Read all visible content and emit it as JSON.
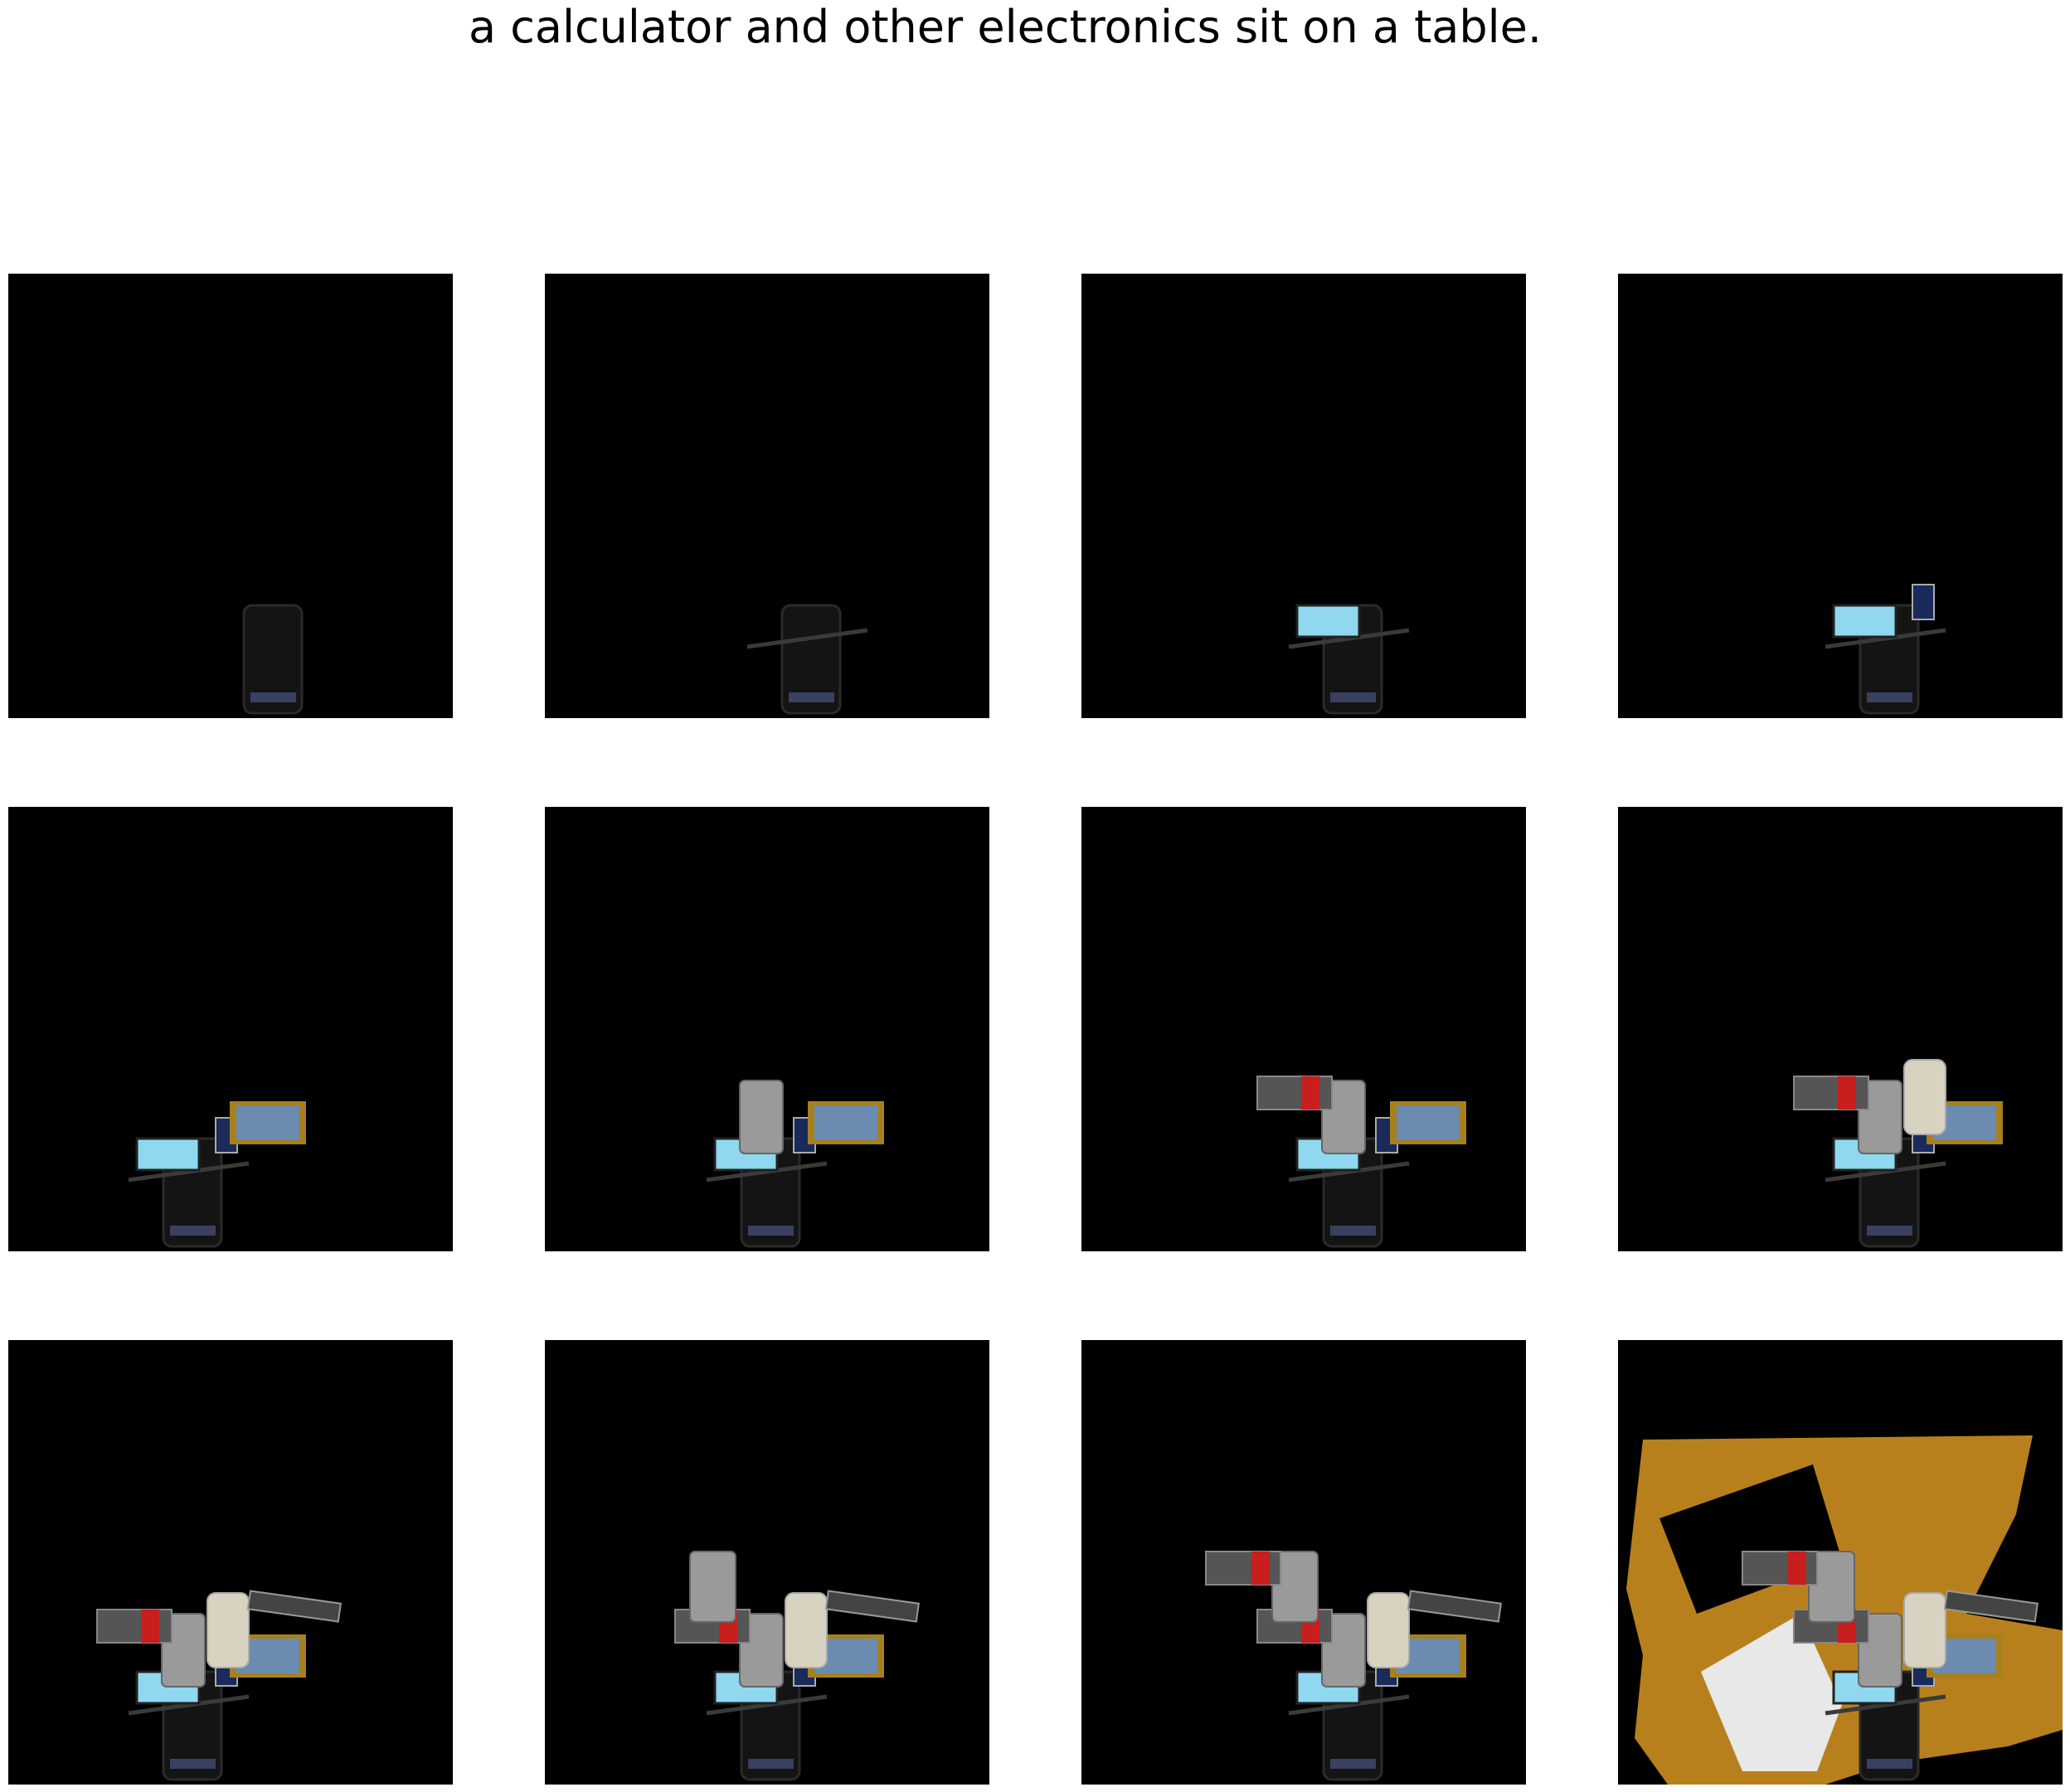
{
  "caption": "a calculator and other electronics sit on a table.",
  "grid": {
    "rows": 3,
    "cols": 4
  },
  "panels": [
    {
      "step": 1,
      "objects": [
        "phone-dark"
      ]
    },
    {
      "step": 2,
      "objects": [
        "phone-dark",
        "pen"
      ]
    },
    {
      "step": 3,
      "objects": [
        "phone-dark",
        "pen",
        "laptop-screen"
      ]
    },
    {
      "step": 4,
      "objects": [
        "phone-dark",
        "pen",
        "laptop-screen",
        "small-phone"
      ]
    },
    {
      "step": 5,
      "objects": [
        "phone-dark",
        "pen",
        "laptop-screen",
        "small-phone",
        "pda-gold"
      ]
    },
    {
      "step": 6,
      "objects": [
        "phone-dark",
        "pen",
        "laptop-screen",
        "small-phone",
        "pda-gold",
        "calculator-silver"
      ]
    },
    {
      "step": 7,
      "objects": [
        "phone-dark",
        "pen",
        "laptop-screen",
        "small-phone",
        "pda-gold",
        "calculator-silver",
        "phone-red"
      ]
    },
    {
      "step": 8,
      "objects": [
        "phone-dark",
        "pen",
        "laptop-screen",
        "small-phone",
        "pda-gold",
        "calculator-silver",
        "phone-red",
        "phone-white"
      ]
    },
    {
      "step": 9,
      "objects": [
        "phone-dark",
        "pen",
        "laptop-screen",
        "small-phone",
        "pda-gold",
        "calculator-silver",
        "phone-red",
        "phone-white",
        "remote"
      ]
    },
    {
      "step": 10,
      "objects": [
        "phone-dark",
        "pen",
        "laptop-screen",
        "small-phone",
        "pda-gold",
        "calculator-silver",
        "phone-red",
        "phone-white",
        "remote",
        "calculator-silver-2"
      ]
    },
    {
      "step": 11,
      "objects": [
        "phone-dark",
        "pen",
        "laptop-screen",
        "small-phone",
        "pda-gold",
        "calculator-silver",
        "phone-red",
        "phone-white",
        "remote",
        "calculator-silver-2",
        "phone-red-2"
      ]
    },
    {
      "step": 12,
      "objects": [
        "phone-dark",
        "pen",
        "laptop-screen",
        "small-phone",
        "pda-gold",
        "calculator-silver",
        "phone-red",
        "phone-white",
        "remote",
        "calculator-silver-2",
        "phone-red-2",
        "wood-table"
      ]
    }
  ],
  "colors": {
    "panel_bg": "#000000",
    "wood": "#b8801c",
    "screen": "#8fd8f0",
    "pda_frame": "#a5801c",
    "silver": "#9a9a9a",
    "red": "#c81e1e",
    "white_phone": "#d8d2c0"
  }
}
